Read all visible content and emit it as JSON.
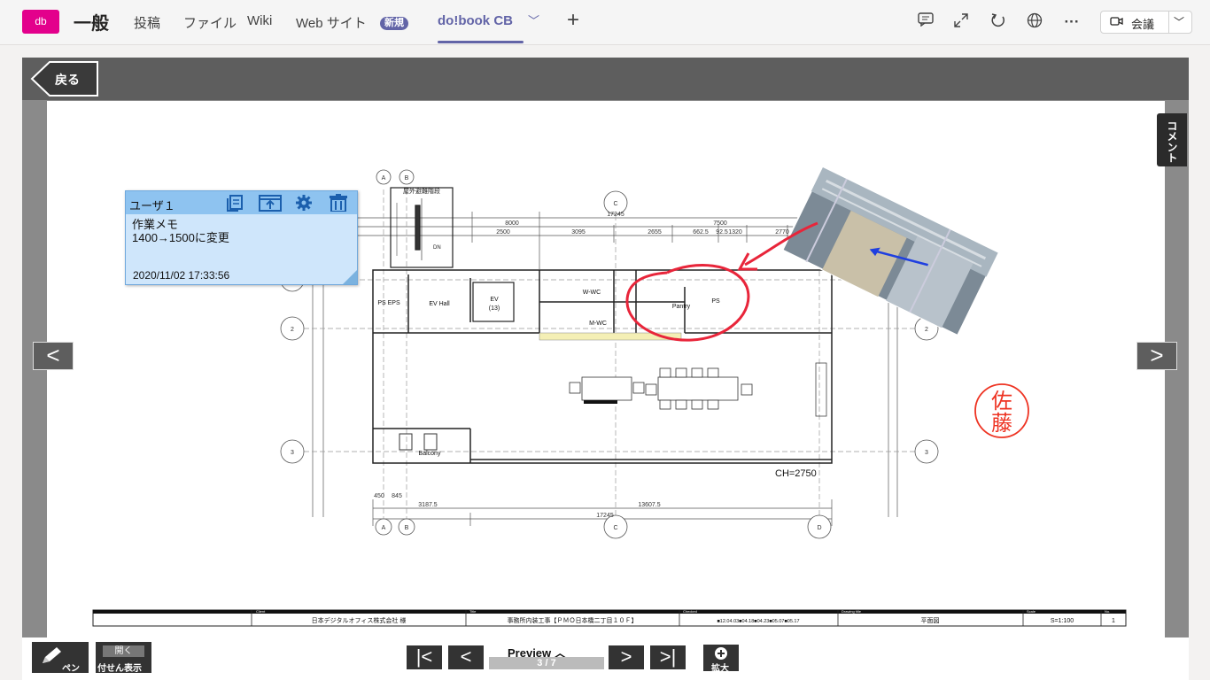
{
  "teams": {
    "logo": "db",
    "team_name": "一般",
    "tabs": [
      "投稿",
      "ファイル",
      "Wiki",
      "Web サイト",
      "do!book CB"
    ],
    "new_badge": "新規",
    "add_tab": "+",
    "active_chevron": "﹀",
    "meet_label": "会議",
    "header_icons": [
      "chat-icon",
      "expand-icon",
      "refresh-icon",
      "globe-icon",
      "more-icon"
    ]
  },
  "viewer": {
    "back_label": "戻る",
    "comment_label": "コメント",
    "prev_page_arrow": "<",
    "next_page_arrow": ">"
  },
  "note": {
    "user": "ユーザ１",
    "line1": "作業メモ",
    "line2": "1400→1500に変更",
    "date": "2020/11/02 17:33:56"
  },
  "drawing": {
    "stair_label": "屋外避難階段",
    "dn_label": "DN",
    "rooms": [
      "PS EPS",
      "EV Hall",
      "EV",
      "(13)",
      "W-WC",
      "M-WC",
      "Pantry",
      "PS",
      "Balcony"
    ],
    "ch_label": "CH=2750",
    "top_dims": [
      "17245",
      "8000",
      "7500",
      "2500",
      "3095",
      "2655",
      "662.5",
      "92.5",
      "1320",
      "2770"
    ],
    "bottom_dims": [
      "450",
      "845",
      "3187.5",
      "13607.5",
      "17245"
    ],
    "grid_letters": [
      "A",
      "B",
      "C",
      "D"
    ],
    "grid_numbers": [
      "1",
      "2",
      "3"
    ],
    "stamp_chars": [
      "佐",
      "藤"
    ]
  },
  "title_block": {
    "client_header": "Client",
    "client": "日本デジタルオフィス株式会社 様",
    "title_header": "Title",
    "title": "事務所内装工事【ＰＭＯ日本橋二丁目１０Ｆ】",
    "checked_header": "Checked",
    "checked": "■12.04.03■04.18■04.23■05.07■05.17",
    "drawing_header": "Drawing title",
    "drawing_title": "平面図",
    "scale_header": "Scale",
    "scale": "S=1:100",
    "no_header": "No.",
    "no": "1"
  },
  "toolbar": {
    "pen_label": "ペン",
    "fusen_top": "開く",
    "fusen_bottom": "付せん表示",
    "preview_label": "Preview ︿",
    "page_indicator": "3 / 7",
    "first_label": "|<",
    "prev_label": "<",
    "next_label": ">",
    "last_label": ">|",
    "zoom_label": "拡大"
  },
  "colors": {
    "teams_accent": "#6264a7",
    "logo_bg": "#e3008c",
    "annotation_red": "#e8253a",
    "note_bg": "#cfe6fb"
  }
}
